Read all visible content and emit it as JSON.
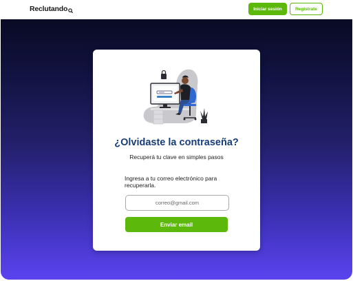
{
  "header": {
    "logo_text": "Reclutando",
    "login_label": "Iniciar sesión",
    "register_label": "Registrate"
  },
  "card": {
    "title": "¿Olvidaste la contraseña?",
    "subtitle": "Recuperá tu clave en simples pasos",
    "instruction": "Ingresa a tu correo electrónico para recuperarla.",
    "email_placeholder": "correo@gmail.com",
    "submit_label": "Enviar email"
  },
  "colors": {
    "brand_green": "#5cb80a",
    "title_blue": "#173d78",
    "background_top": "#090a23",
    "background_bottom": "#5a43ef"
  },
  "icons": {
    "logo_mark": "magnifier-icon",
    "illustration": "person-at-computer-with-lock"
  }
}
